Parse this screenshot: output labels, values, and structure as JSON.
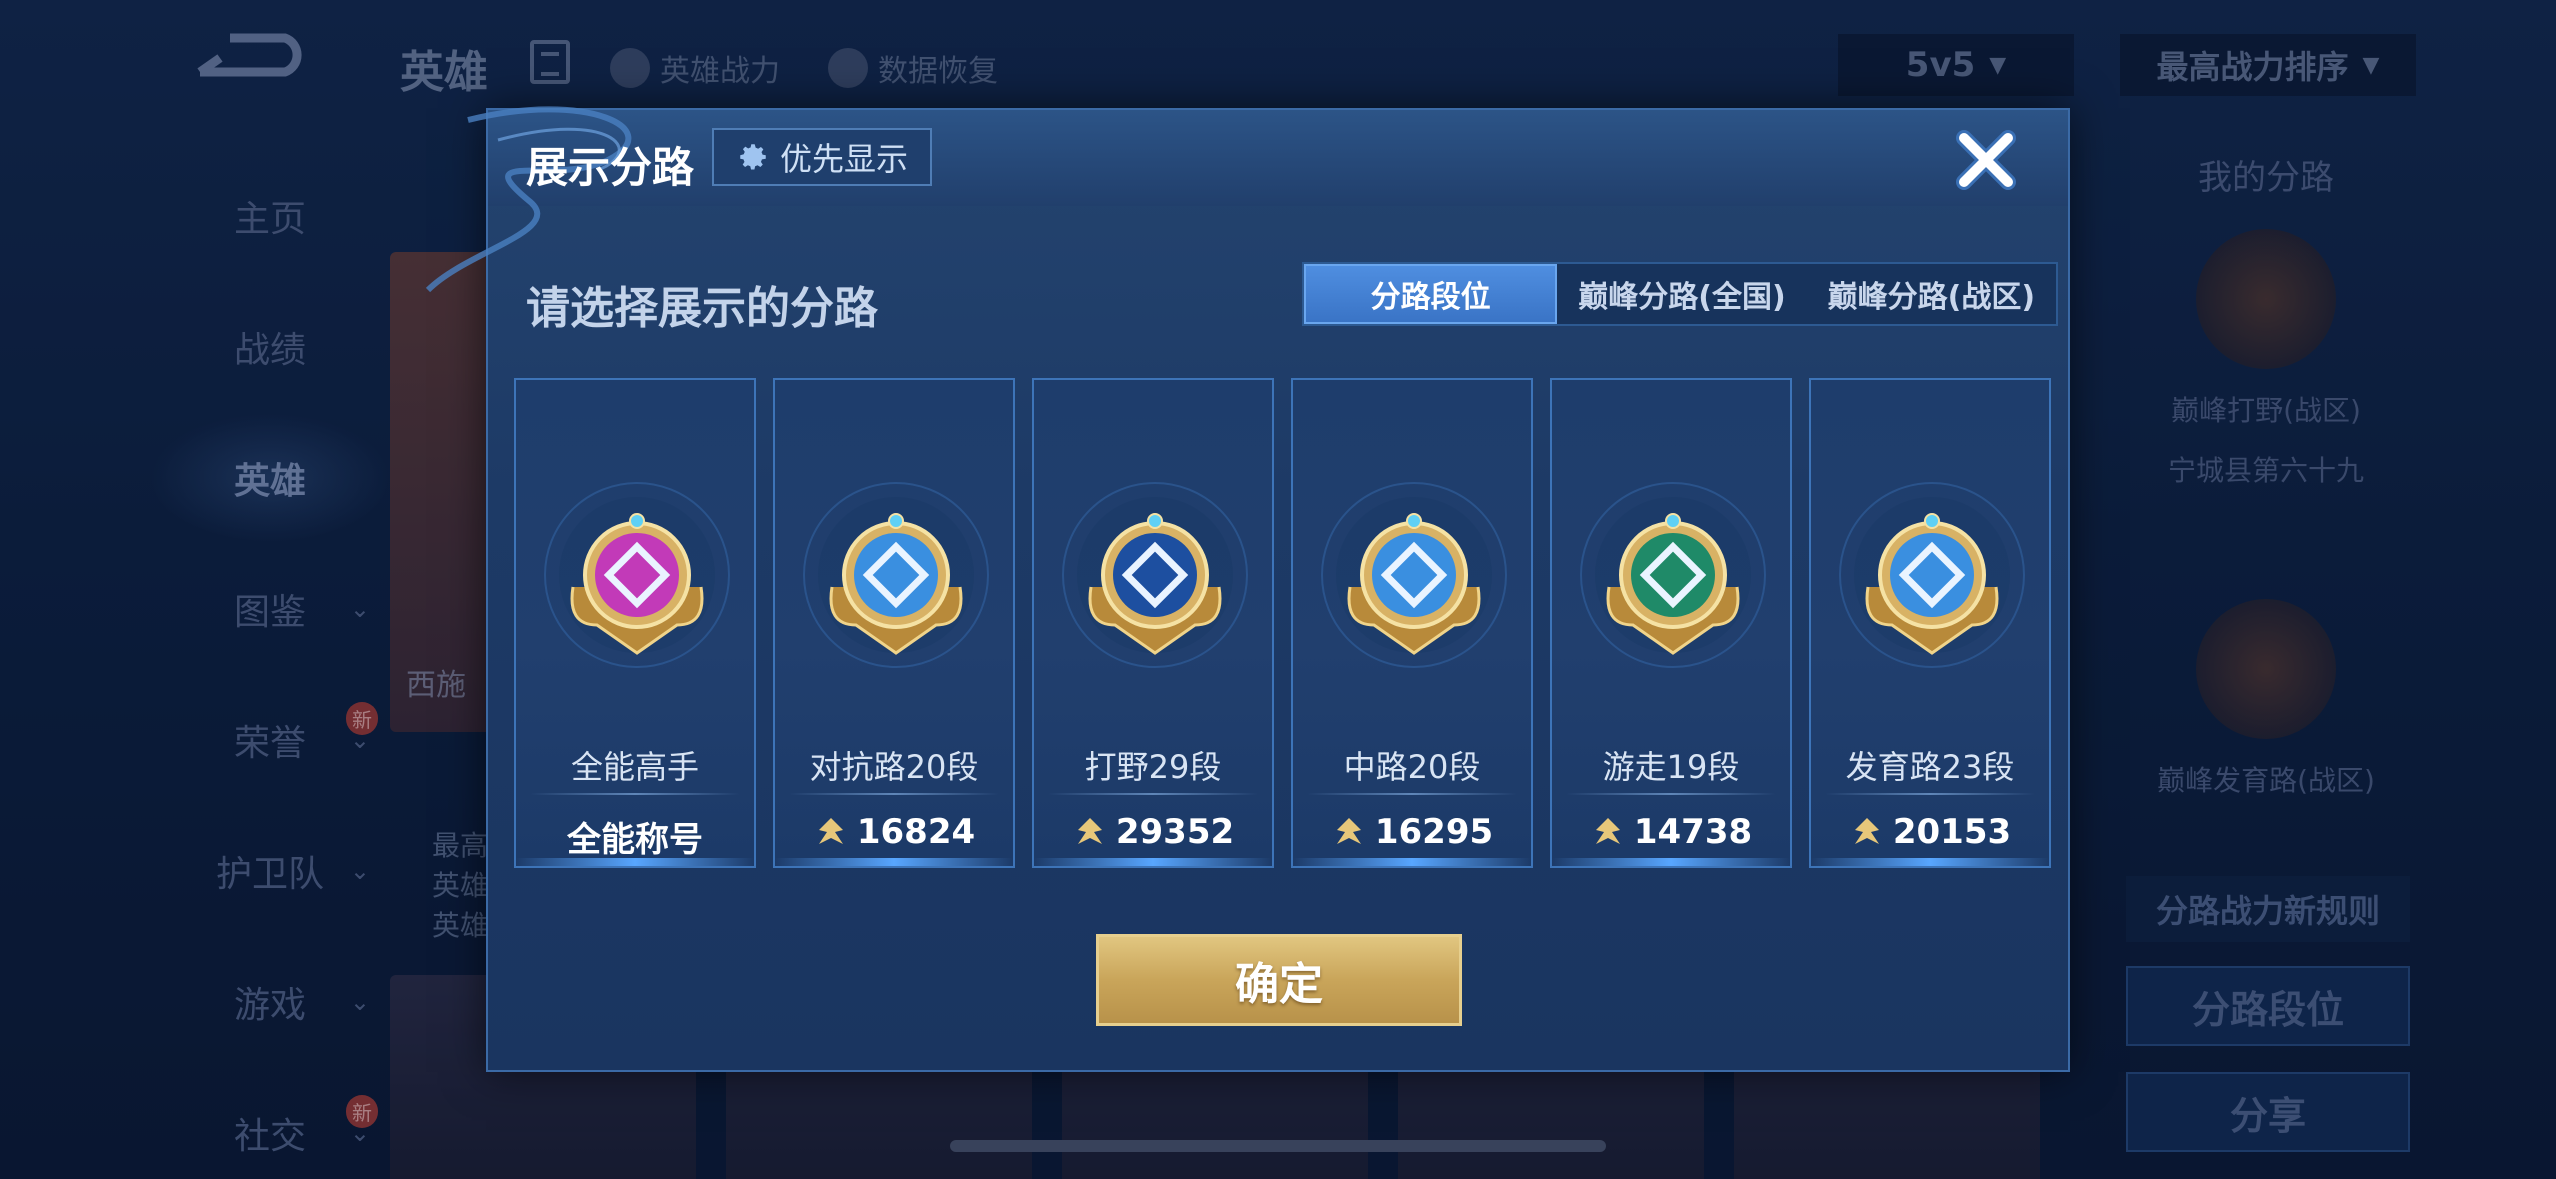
{
  "topbar": {
    "title": "英雄",
    "link_power": "英雄战力",
    "link_restore": "数据恢复",
    "mode": "5v5",
    "sort": "最高战力排序"
  },
  "side_nav": [
    {
      "label": "主页"
    },
    {
      "label": "战绩"
    },
    {
      "label": "英雄"
    },
    {
      "label": "图鉴"
    },
    {
      "label": "荣誉",
      "badge": "新"
    },
    {
      "label": "护卫队"
    },
    {
      "label": "游戏"
    },
    {
      "label": "社交",
      "badge": "新"
    }
  ],
  "hero": {
    "name": "西施",
    "lines": [
      "最高",
      "英雄",
      "英雄"
    ]
  },
  "right_panel": {
    "title": "我的分路",
    "badge1_label": "巅峰打野(战区)",
    "badge1_sub": "宁城县第六十九",
    "badge2_label": "巅峰发育路(战区)",
    "rules_btn": "分路战力新规则",
    "segment_btn": "分路段位",
    "share_btn": "分享"
  },
  "modal": {
    "title": "展示分路",
    "priority_btn": "优先显示",
    "prompt": "请选择展示的分路",
    "tabs": [
      "分路段位",
      "巅峰分路(全国)",
      "巅峰分路(战区)"
    ],
    "active_tab": 0,
    "cards": [
      {
        "label": "全能高手",
        "value": "全能称号",
        "emblem": "allround-emblem",
        "color": "#c23ab8",
        "show_power_icon": false
      },
      {
        "label": "对抗路20段",
        "value": "16824",
        "emblem": "clash-lane-emblem",
        "color": "#3a8fe0",
        "show_power_icon": true
      },
      {
        "label": "打野29段",
        "value": "29352",
        "emblem": "jungle-emblem",
        "color": "#1d4fa0",
        "show_power_icon": true
      },
      {
        "label": "中路20段",
        "value": "16295",
        "emblem": "mid-lane-emblem",
        "color": "#3a8fe0",
        "show_power_icon": true
      },
      {
        "label": "游走19段",
        "value": "14738",
        "emblem": "roam-emblem",
        "color": "#1f8a68",
        "show_power_icon": true
      },
      {
        "label": "发育路23段",
        "value": "20153",
        "emblem": "farm-lane-emblem",
        "color": "#3a8fe0",
        "show_power_icon": true
      }
    ],
    "confirm": "确定"
  }
}
